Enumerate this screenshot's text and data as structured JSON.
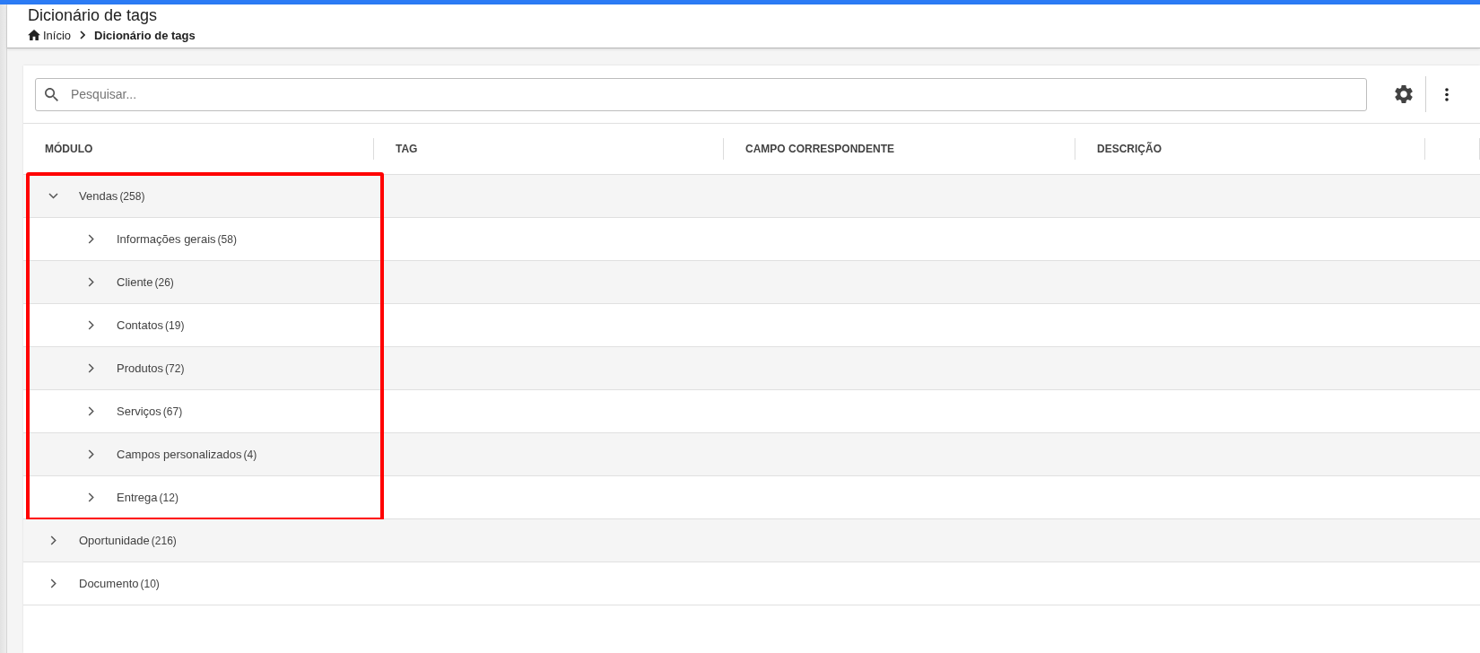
{
  "header": {
    "title": "Dicionário de tags",
    "breadcrumb": [
      {
        "label": "Início",
        "kind": "home"
      },
      {
        "label": "Dicionário de tags",
        "kind": "current"
      }
    ]
  },
  "toolbar": {
    "search": {
      "placeholder": "Pesquisar..."
    }
  },
  "table": {
    "columns": [
      "MÓDULO",
      "TAG",
      "CAMPO CORRESPONDENTE",
      "DESCRIÇÃO"
    ],
    "rows": [
      {
        "label": "Vendas",
        "count": "(258)",
        "expanded": true,
        "highlighted": true,
        "children": [
          {
            "label": "Informações gerais",
            "count": "(58)",
            "expanded": false
          },
          {
            "label": "Cliente",
            "count": "(26)",
            "expanded": false
          },
          {
            "label": "Contatos",
            "count": "(19)",
            "expanded": false
          },
          {
            "label": "Produtos",
            "count": "(72)",
            "expanded": false
          },
          {
            "label": "Serviços",
            "count": "(67)",
            "expanded": false
          },
          {
            "label": "Campos personalizados",
            "count": "(4)",
            "expanded": false
          },
          {
            "label": "Entrega",
            "count": "(12)",
            "expanded": false
          }
        ]
      },
      {
        "label": "Oportunidade",
        "count": "(216)",
        "expanded": false,
        "highlighted": false
      },
      {
        "label": "Documento",
        "count": "(10)",
        "expanded": false,
        "highlighted": false
      }
    ]
  }
}
